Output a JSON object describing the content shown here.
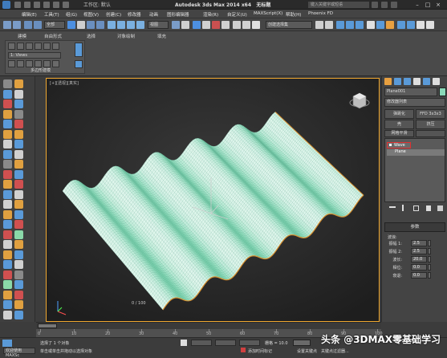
{
  "title_bar": {
    "workspace": "工作区: 默认",
    "app_title": "Autodesk 3ds Max  2014 x64",
    "doc_title": "无标题",
    "search_placeholder": "键入关键字或短语"
  },
  "menu": [
    "编辑(E)",
    "工具(T)",
    "组(G)",
    "视图(V)",
    "创建(C)",
    "修改器",
    "动画",
    "图形编辑器",
    "渲染(R)",
    "自定义(U)",
    "MAXScript(X)",
    "帮助(H)",
    "Phoenix FD"
  ],
  "toolbar": {
    "selection_filter": "全部",
    "ref_coord": "视图",
    "selection_set": "创建选择集"
  },
  "ribbon": {
    "tabs": [
      "建模",
      "自由形式",
      "选择",
      "对象绘制",
      "填充"
    ],
    "panel_field": "1: Views",
    "panel_label": "多边形建模"
  },
  "viewport": {
    "label": "[+][透视][真实]",
    "frame_counter": "0 / 100"
  },
  "command_panel": {
    "object_name": "Plane001",
    "modifier_list": "修改器列表",
    "buttons": [
      "弹跳化",
      "FFD 3x3x3",
      "壳",
      "挤压",
      "网格平滑",
      ""
    ],
    "stack": [
      "Wave",
      "Plane"
    ],
    "rollout_title": "参数",
    "params_group": "波浪:",
    "params": [
      {
        "label": "振幅 1:",
        "value": "2.5"
      },
      {
        "label": "振幅 2:",
        "value": "2.5"
      },
      {
        "label": "波长:",
        "value": "20.0"
      },
      {
        "label": "相位:",
        "value": "0.0"
      },
      {
        "label": "衰退:",
        "value": "0.0"
      }
    ]
  },
  "timeline": {
    "ticks": [
      "0",
      "10",
      "20",
      "30",
      "40",
      "50",
      "60",
      "70",
      "80",
      "90",
      "100"
    ]
  },
  "status": {
    "maxscript_label": "欢迎使用 MAXSc",
    "selection_info": "选择了 1 个对象",
    "prompt": "单击或单击并拖动以选择对象",
    "grid": "栅格 = 10.0",
    "add_time_tag": "添加时间标记",
    "set_key": "设置关键点",
    "key_filters": "关键点过滤器..."
  },
  "watermark": "头条 @3DMAX零基础学习"
}
